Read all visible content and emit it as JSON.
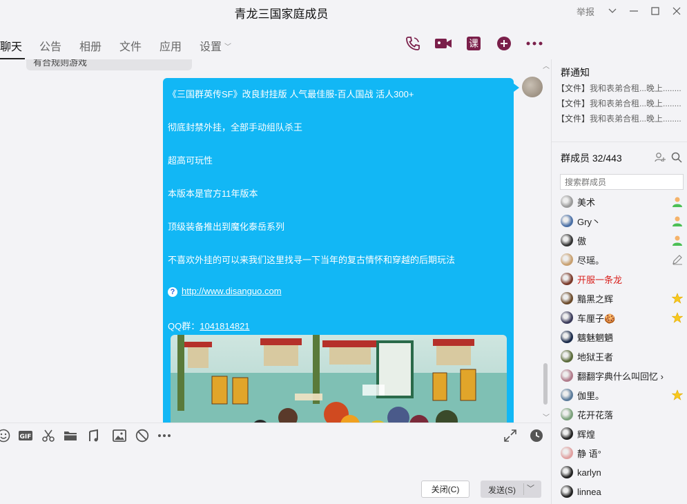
{
  "window": {
    "title": "青龙三国家庭成员",
    "report_label": "举报"
  },
  "tabs": [
    {
      "label": "聊天",
      "active": true
    },
    {
      "label": "公告"
    },
    {
      "label": "相册"
    },
    {
      "label": "文件"
    },
    {
      "label": "应用"
    },
    {
      "label": "设置",
      "has_caret": true
    }
  ],
  "tab_actions": [
    "phone-icon",
    "video-icon",
    "lesson-icon",
    "add-icon",
    "more-icon"
  ],
  "tab_action_labels": {
    "lesson": "课"
  },
  "chat": {
    "previous_message_fragment": "有合规则游戏",
    "message_lines": [
      "《三国群英传SF》改良封挂版 人气最佳服-百人国战 活人300+",
      "彻底封禁外挂，全部手动组队杀王",
      "超高可玩性",
      "本版本是官方11年版本",
      "顶级装备推出到魔化泰岳系列",
      "不喜欢外挂的可以来我们这里找寻一下当年的复古情怀和穿越的后期玩法"
    ],
    "link": "http://www.disanguo.com",
    "qq_prefix": "QQ群：",
    "qq_number": "1041814821",
    "bubble_color": "#12b7f5"
  },
  "input_toolbar": [
    "emoji-icon",
    "gif-icon",
    "scissors-icon",
    "folder-icon",
    "music-icon",
    "image-icon",
    "shake-icon",
    "more-dots-icon"
  ],
  "input_toolbar_right": [
    "expand-icon",
    "history-clock-icon"
  ],
  "buttons": {
    "close": "关闭(C)",
    "send": "发送(S)"
  },
  "right_panel": {
    "notice_title": "群通知",
    "notices": [
      {
        "prefix": "【文件】",
        "text": "我和表弟合租...晚上",
        "dots": "........"
      },
      {
        "prefix": "【文件】",
        "text": "我和表弟合租...晚上",
        "dots": "........"
      },
      {
        "prefix": "【文件】",
        "text": "我和表弟合租...晚上",
        "dots": "........"
      }
    ],
    "members_title": "群成员 32/443",
    "search_placeholder": "搜索群成员",
    "members": [
      {
        "name": "美术",
        "badge": "admin-icon",
        "avatar_color": "#9a9a9a"
      },
      {
        "name": "Gry丶",
        "badge": "admin-icon",
        "avatar_color": "#4a6fa5"
      },
      {
        "name": "傲",
        "badge": "admin-icon",
        "avatar_color": "#333333"
      },
      {
        "name": "尽瑶。",
        "badge": "edit-icon",
        "avatar_color": "#c8a070"
      },
      {
        "name": "开服一条龙",
        "badge": "",
        "name_color": "#d9201c",
        "avatar_color": "#7a3a2a"
      },
      {
        "name": "黯黑之辉",
        "badge": "star-icon",
        "avatar_color": "#6b4a2a"
      },
      {
        "name": "车厘子🍪",
        "badge": "star-icon",
        "avatar_color": "#3a3a5a"
      },
      {
        "name": "魑魅魍魉",
        "badge": "",
        "avatar_color": "#1a2a4a"
      },
      {
        "name": "地狱王者",
        "badge": "",
        "avatar_color": "#5a6a3a"
      },
      {
        "name": "翻翻字典什么叫回忆 ›",
        "badge": "",
        "avatar_color": "#b07a8a"
      },
      {
        "name": "伽里。",
        "badge": "star-icon",
        "avatar_color": "#5a7a9a"
      },
      {
        "name": "花开花落",
        "badge": "",
        "avatar_color": "#7aa07a"
      },
      {
        "name": "辉煌",
        "badge": "",
        "avatar_color": "#222222"
      },
      {
        "name": "静 语°",
        "badge": "",
        "avatar_color": "#e0a0a0"
      },
      {
        "name": "karlyn",
        "badge": "",
        "avatar_color": "#222222"
      },
      {
        "name": "linnea",
        "badge": "",
        "avatar_color": "#222222"
      }
    ]
  }
}
